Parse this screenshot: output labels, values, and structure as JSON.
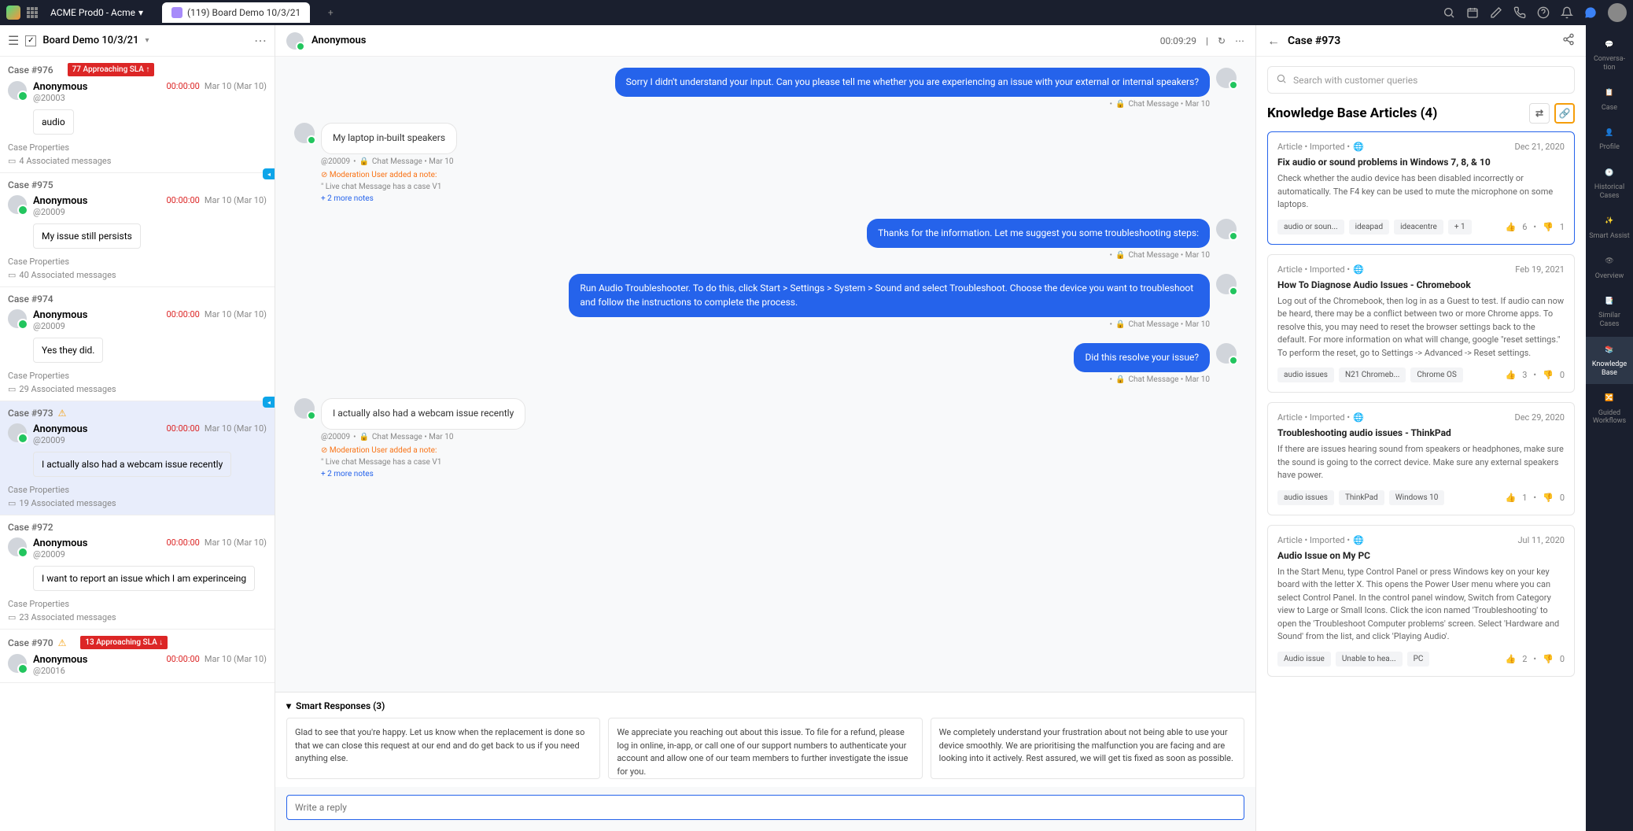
{
  "topbar": {
    "workspace": "ACME Prod0 - Acme",
    "tab_label": "(119) Board Demo 10/3/21"
  },
  "caselist": {
    "title": "Board Demo 10/3/21",
    "cases": [
      {
        "id": "Case #976",
        "sla": "77 Approaching SLA",
        "sla_dir": "up",
        "name": "Anonymous",
        "handle": "@20003",
        "timer": "00:00:00",
        "date": "Mar 10 (Mar 10)",
        "preview": "audio",
        "props": "Case Properties",
        "assoc": "4 Associated messages"
      },
      {
        "id": "Case #975",
        "name": "Anonymous",
        "handle": "@20009",
        "timer": "00:00:00",
        "date": "Mar 10 (Mar 10)",
        "preview": "My issue still persists",
        "props": "Case Properties",
        "assoc": "40 Associated messages"
      },
      {
        "id": "Case #974",
        "name": "Anonymous",
        "handle": "@20009",
        "timer": "00:00:00",
        "date": "Mar 10 (Mar 10)",
        "preview": "Yes they did.",
        "props": "Case Properties",
        "assoc": "29 Associated messages"
      },
      {
        "id": "Case #973",
        "warn": true,
        "active": true,
        "name": "Anonymous",
        "handle": "@20009",
        "timer": "00:00:00",
        "date": "Mar 10 (Mar 10)",
        "preview": "I actually also had a webcam issue recently",
        "props": "Case Properties",
        "assoc": "19 Associated messages"
      },
      {
        "id": "Case #972",
        "name": "Anonymous",
        "handle": "@20009",
        "timer": "00:00:00",
        "date": "Mar 10 (Mar 10)",
        "preview": "I want to report an issue which I am experinceing",
        "props": "Case Properties",
        "assoc": "23 Associated messages"
      },
      {
        "id": "Case #970",
        "warn": true,
        "sla": "13 Approaching SLA",
        "sla_dir": "down",
        "name": "Anonymous",
        "handle": "@20016",
        "timer": "00:00:00",
        "date": "Mar 10 (Mar 10)"
      }
    ]
  },
  "convo": {
    "name": "Anonymous",
    "elapsed": "00:09:29",
    "messages": [
      {
        "dir": "out",
        "text": "Sorry I didn't understand your input. Can you please tell me whether you are experiencing an issue with your external or internal speakers?",
        "meta": "Chat Message • Mar 10"
      },
      {
        "dir": "in",
        "text": "My laptop in-built speakers",
        "sub_handle": "@20009",
        "sub_meta": "Chat Message • Mar 10",
        "mod": "Moderation User added a note:",
        "note": "Live chat Message has a case V1",
        "more": "+ 2 more notes"
      },
      {
        "dir": "out",
        "text": "Thanks for the information. Let me suggest you some troubleshooting steps:",
        "meta": "Chat Message • Mar 10"
      },
      {
        "dir": "out",
        "text": "Run Audio Troubleshooter. To do this, click Start > Settings > System > Sound and select Troubleshoot. Choose the device you want to troubleshoot and follow the instructions to complete the process.",
        "meta": "Chat Message • Mar 10"
      },
      {
        "dir": "out",
        "text": "Did this resolve your issue?",
        "meta": "Chat Message • Mar 10"
      },
      {
        "dir": "in",
        "text": "I actually also had a webcam issue recently",
        "sub_handle": "@20009",
        "sub_meta": "Chat Message • Mar 10",
        "mod": "Moderation User added a note:",
        "note": "Live chat Message has a case V1",
        "more": "+ 2 more notes"
      }
    ],
    "smart_title": "Smart Responses (3)",
    "smart": [
      "Glad to see that you're happy. Let us know when the replacement is done so that we can close this request at our end and do get back to us if you need anything else.",
      "We appreciate you reaching out about this issue. To file for a refund, please log in online, in-app, or call one of our support numbers to authenticate your account and allow one of our team members to further investigate the issue for you.",
      "We completely understand your frustration about not being able to use your device smoothly. We are prioritising the malfunction you are facing and are looking into it actively. Rest assured, we will get tis fixed as soon as possible."
    ],
    "reply_placeholder": "Write a reply"
  },
  "kb": {
    "header_title": "Case #973",
    "search_placeholder": "Search with customer queries",
    "section_title": "Knowledge Base Articles (4)",
    "articles": [
      {
        "selected": true,
        "meta": "Article • Imported •",
        "date": "Dec 21, 2020",
        "title": "Fix audio or sound problems in Windows 7, 8, & 10",
        "desc": "Check whether the audio device has been disabled incorrectly or automatically. The F4 key can be used to mute the microphone on some laptops.",
        "tags": [
          "audio or soun...",
          "ideapad",
          "ideacentre",
          "+ 1"
        ],
        "up": "6",
        "down": "1"
      },
      {
        "meta": "Article • Imported •",
        "date": "Feb 19, 2021",
        "title": "How To Diagnose Audio Issues - Chromebook",
        "desc": "Log out of the Chromebook, then log in as a Guest to test. If audio can now be heard, there may be a conflict between two or more Chrome apps. To resolve this, you may need to reset the browser settings back to the default. For more information on what will change, google \"reset settings.\" To perform the reset, go to Settings -> Advanced -> Reset settings.",
        "tags": [
          "audio issues",
          "N21 Chromeb...",
          "Chrome OS"
        ],
        "up": "3",
        "down": "0"
      },
      {
        "meta": "Article • Imported •",
        "date": "Dec 29, 2020",
        "title": "Troubleshooting audio issues - ThinkPad",
        "desc": "If there are issues hearing sound from speakers or headphones, make sure the sound is going to the correct device. Make sure any external speakers have power.",
        "tags": [
          "audio issues",
          "ThinkPad",
          "Windows 10"
        ],
        "up": "1",
        "down": "0"
      },
      {
        "meta": "Article • Imported •",
        "date": "Jul 11, 2020",
        "title": "Audio Issue on My PC",
        "desc": "In the Start Menu, type Control Panel or press Windows key on your key board with the letter X. This opens the Power User menu where you can select Control Panel. In the control panel window, Switch from Category view to Large or Small Icons. Click the icon named 'Troubleshooting' to open the 'Troubleshoot Computer problems' screen. Select 'Hardware and Sound' from the list, and click 'Playing Audio'.",
        "tags": [
          "Audio issue",
          "Unable to hea...",
          "PC"
        ],
        "up": "2",
        "down": "0"
      }
    ]
  },
  "rail": [
    {
      "label": "Conversa-tion"
    },
    {
      "label": "Case"
    },
    {
      "label": "Profile"
    },
    {
      "label": "Historical Cases"
    },
    {
      "label": "Smart Assist"
    },
    {
      "label": "Overview"
    },
    {
      "label": "Similar Cases"
    },
    {
      "label": "Knowledge Base",
      "active": true
    },
    {
      "label": "Guided Workflows"
    }
  ]
}
